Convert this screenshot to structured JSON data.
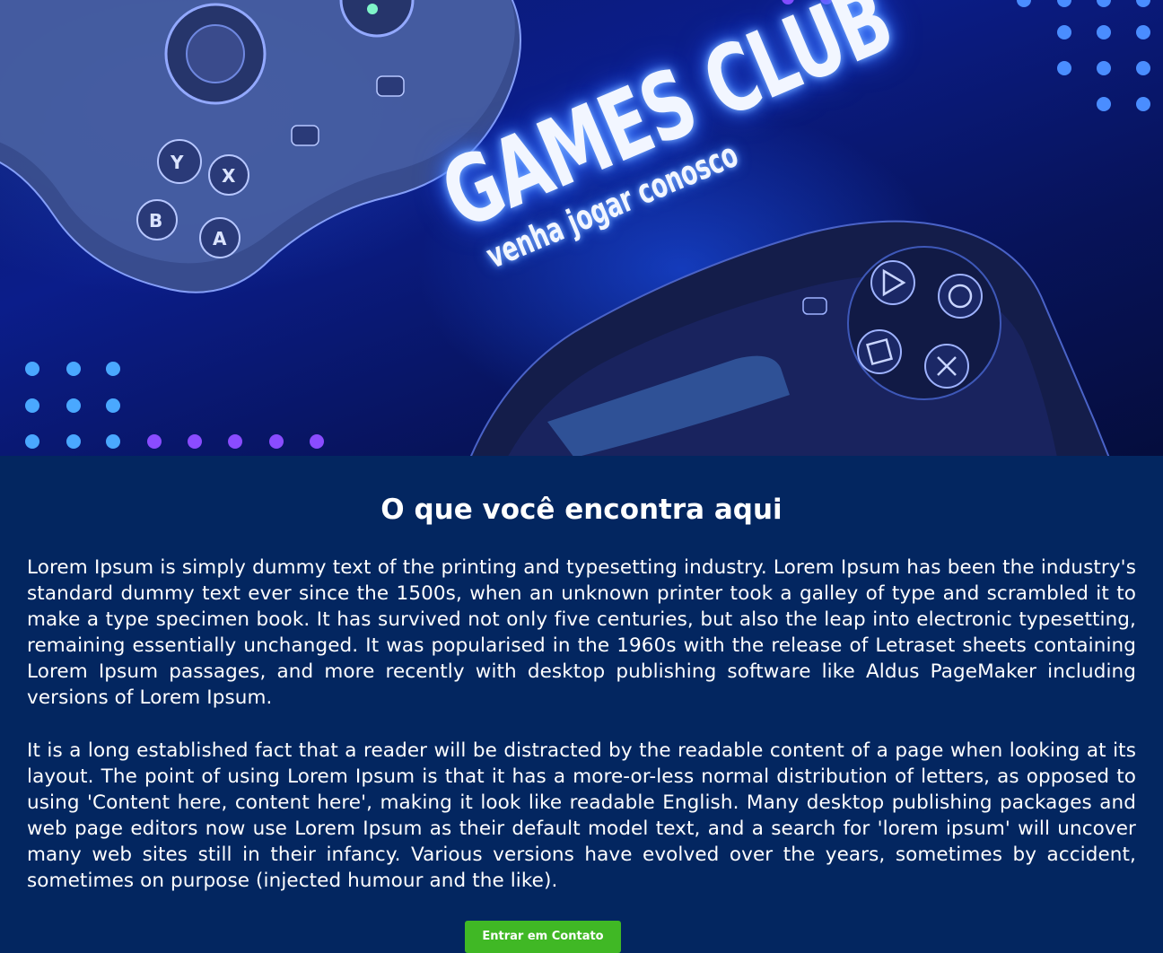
{
  "hero": {
    "title": "GAMES CLUB",
    "tagline": "venha jogar conosco"
  },
  "main": {
    "section_title": "O que você encontra aqui",
    "paragraphs": [
      "Lorem Ipsum is simply dummy text of the printing and typesetting industry. Lorem Ipsum has been the industry's standard dummy text ever since the 1500s, when an unknown printer took a galley of type and scrambled it to make a type specimen book. It has survived not only five centuries, but also the leap into electronic typesetting, remaining essentially unchanged. It was popularised in the 1960s with the release of Letraset sheets containing Lorem Ipsum passages, and more recently with desktop publishing software like Aldus PageMaker including versions of Lorem Ipsum.",
      "It is a long established fact that a reader will be distracted by the readable content of a page when looking at its layout. The point of using Lorem Ipsum is that it has a more-or-less normal distribution of letters, as opposed to using 'Content here, content here', making it look like readable English. Many desktop publishing packages and web page editors now use Lorem Ipsum as their default model text, and a search for 'lorem ipsum' will uncover many web sites still in their infancy. Various versions have evolved over the years, sometimes by accident, sometimes on purpose (injected humour and the like)."
    ]
  },
  "cta": {
    "label": "Entrar em Contato"
  },
  "colors": {
    "page_background": "#032660",
    "button_background": "#40b825",
    "text": "#ffffff",
    "neon_glow": "#3f7dff"
  },
  "icons": {
    "hero_art": [
      "xbox-controller-icon",
      "playstation-controller-icon",
      "dot-pattern-icon"
    ]
  }
}
